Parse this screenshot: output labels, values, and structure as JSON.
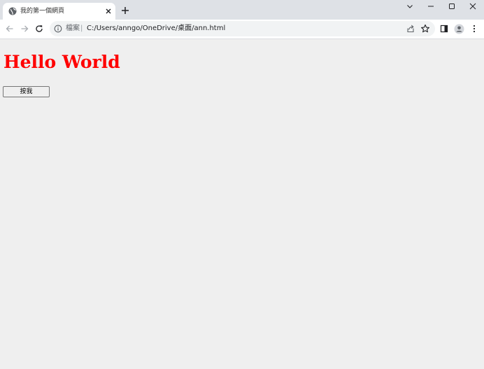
{
  "tab": {
    "title": "我的第一個網頁"
  },
  "address_bar": {
    "site_label": "檔案",
    "separator": "|",
    "url": "C:/Users/anngo/OneDrive/桌面/ann.html"
  },
  "page": {
    "heading": "Hello World",
    "heading_color": "#ff0000",
    "button_label": "按我"
  },
  "icons": {
    "favicon": "globe-icon",
    "tab_close": "close-icon",
    "new_tab": "plus-icon",
    "tab_search": "chevron-down-icon",
    "minimize": "minimize-icon",
    "maximize": "maximize-icon",
    "close_window": "close-icon",
    "back": "arrow-left-icon",
    "forward": "arrow-right-icon",
    "reload": "reload-icon",
    "site_info": "info-icon",
    "share": "share-icon",
    "bookmark": "star-icon",
    "side_panel": "side-panel-icon",
    "profile": "profile-icon",
    "menu": "kebab-menu-icon"
  },
  "colors": {
    "tab_strip": "#dee1e6",
    "toolbar": "#ffffff",
    "omnibox": "#f1f3f4",
    "page_background": "#efefef"
  }
}
